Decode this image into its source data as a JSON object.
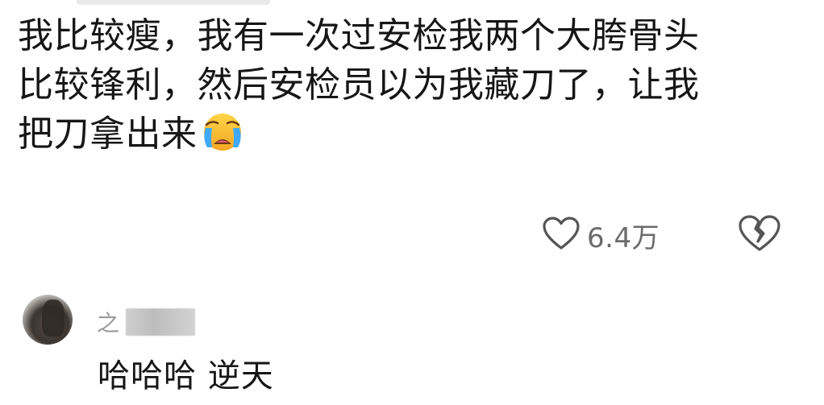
{
  "comment": {
    "line1": "我比较瘦，我有一次过安检我两个大胯骨头",
    "line2": "比较锋利，然后安检员以为我藏刀了，让我",
    "line3": "把刀拿出来",
    "emoji": "crying-face-emoji"
  },
  "actions": {
    "like_icon": "heart-icon",
    "like_count": "6.4万",
    "dislike_icon": "broken-heart-icon"
  },
  "reply": {
    "avatar_icon": "avatar",
    "username_initial": "之",
    "text": "哈哈哈 逆天"
  },
  "colors": {
    "text": "#161616",
    "meta": "#6b6b6b",
    "icon": "#555555"
  }
}
